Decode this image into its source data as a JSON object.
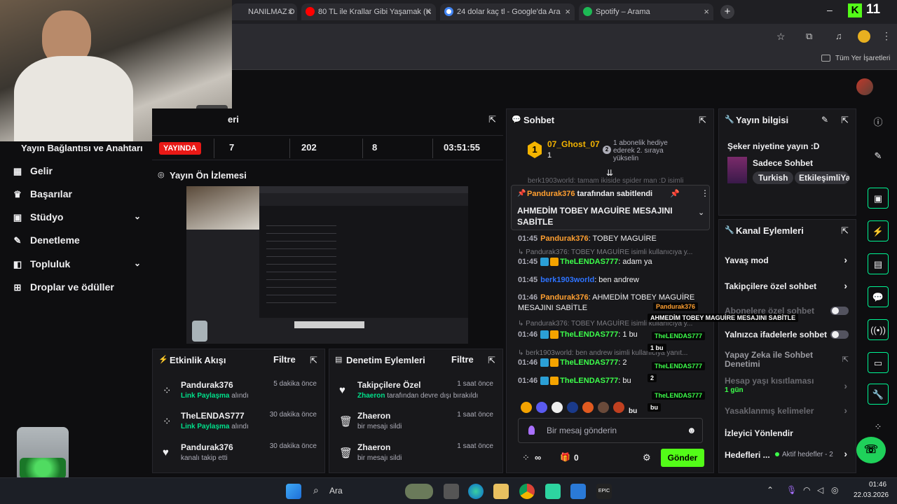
{
  "browser": {
    "tabs": [
      {
        "label": "NANILMAZ D",
        "color": "#cc3333"
      },
      {
        "label": "80 TL ile Krallar Gibi Yaşamak (K",
        "color": "#ff0000"
      },
      {
        "label": "24 dolar kaç tl - Google'da Ara",
        "color": "#4285f4"
      },
      {
        "label": "Spotify – Arama",
        "color": "#1db954"
      }
    ],
    "brand_count": "11",
    "bookmarks_label": "Tüm Yer İşaretleri"
  },
  "sidebar": {
    "top_item": "Yayın Bağlantısı ve Anahtarı",
    "items": [
      {
        "label": "Gelir",
        "icon": "money-icon"
      },
      {
        "label": "Başarılar",
        "icon": "trophy-icon"
      },
      {
        "label": "Stüdyo",
        "icon": "studio-icon"
      },
      {
        "label": "Denetleme",
        "icon": "wrench-icon"
      },
      {
        "label": "Topluluk",
        "icon": "community-icon"
      },
      {
        "label": "Droplar ve ödüller",
        "icon": "drops-icon"
      }
    ]
  },
  "stats": {
    "title_partial": "eri",
    "live_badge": "YAYINDA",
    "viewers": "7",
    "followers": "202",
    "subs": "8",
    "uptime": "03:51:55"
  },
  "preview": {
    "title": "Yayın Ön İzlemesi"
  },
  "activity": {
    "title": "Etkinlik Akışı",
    "filter": "Filtre",
    "rows": [
      {
        "name": "Pandurak376",
        "highlight": "Link Paylaşma",
        "rest": " alındı",
        "time": "5 dakika önce",
        "icon": "channel-points-icon"
      },
      {
        "name": "TheLENDAS777",
        "highlight": "Link Paylaşma",
        "rest": " alındı",
        "time": "30 dakika önce",
        "icon": "channel-points-icon"
      },
      {
        "name": "Pandurak376",
        "highlight": "",
        "rest": "kanalı takip etti",
        "time": "30 dakika önce",
        "icon": "heart-icon"
      }
    ]
  },
  "moderation": {
    "title": "Denetim Eylemleri",
    "filter": "Filtre",
    "rows": [
      {
        "name": "Takipçilere Özel",
        "highlight": "Zhaeron",
        "rest": " tarafından devre dışı bırakıldı",
        "time": "1 saat önce",
        "icon": "heart-icon"
      },
      {
        "name": "Zhaeron",
        "highlight": "",
        "rest": "bir mesajı sildi",
        "time": "1 saat önce",
        "icon": "trash-icon"
      },
      {
        "name": "Zhaeron",
        "highlight": "",
        "rest": "bir mesajı sildi",
        "time": "1 saat önce",
        "icon": "trash-icon"
      }
    ]
  },
  "chat": {
    "title": "Sohbet",
    "leader_rank": "1",
    "leader_name": "07_Ghost_07",
    "leader_count": "1",
    "hype_text": "1 abonelik hediye ederek 2. sıraya yükselin",
    "hype_num": "2",
    "scroll_ghost": "berk1903world: tamam ikiside spider man :D isimli",
    "pinned_by_user": "Pandurak376",
    "pinned_by_rest": " tarafından sabitlendi",
    "pinned_message": "AHMEDİM TOBEY MAGUİRE MESAJINI SABİTLE",
    "messages": [
      {
        "kind": "msg",
        "time": "01:45",
        "user": "Pandurak376",
        "ucls": "u1",
        "text": ": TOBEY MAGUİRE",
        "badges": false
      },
      {
        "kind": "reply",
        "text": "↳ Pandurak376: TOBEY MAGUİRE isimli kullanıcıya y..."
      },
      {
        "kind": "msg",
        "time": "01:45",
        "user": "TheLENDAS777",
        "ucls": "u2",
        "text": ": adam ya",
        "badges": true
      },
      {
        "kind": "msg",
        "time": "01:45",
        "user": "berk1903world",
        "ucls": "u3",
        "text": ": ben andrew",
        "badges": false
      },
      {
        "kind": "msg",
        "time": "01:46",
        "user": "Pandurak376",
        "ucls": "u1",
        "text": ": AHMEDİM TOBEY MAGUİRE MESAJINI SABİTLE",
        "badges": false
      },
      {
        "kind": "reply",
        "text": "↳ Pandurak376: TOBEY MAGUİRE isimli kullanıcıya y..."
      },
      {
        "kind": "msg",
        "time": "01:46",
        "user": "TheLENDAS777",
        "ucls": "u2",
        "text": ": 1 bu",
        "badges": true
      },
      {
        "kind": "reply",
        "text": "↳ berk1903world: ben andrew isimli kullanıcıya yanıt..."
      },
      {
        "kind": "msg",
        "time": "01:46",
        "user": "TheLENDAS777",
        "ucls": "u2",
        "text": ": 2",
        "badges": true
      },
      {
        "kind": "msg",
        "time": "01:46",
        "user": "TheLENDAS777",
        "ucls": "u2",
        "text": ": bu",
        "badges": true
      }
    ],
    "emote_text": "bu",
    "input_placeholder": "Bir mesaj gönderin",
    "points": "∞",
    "gift_count": "0",
    "send": "Gönder"
  },
  "stream_info": {
    "title": "Yayın bilgisi",
    "stream_title": "Şeker niyetine yayın :D",
    "category": "Sadece Sohbet",
    "tags": [
      "Turkish",
      "EtkileşimliYa"
    ]
  },
  "channel_actions": {
    "title": "Kanal Eylemleri",
    "items": [
      {
        "label": "Yavaş mod",
        "control": "arrow"
      },
      {
        "label": "Takipçilere özel sohbet",
        "control": "arrow"
      },
      {
        "label": "Abonelere özel sohbet",
        "control": "toggle"
      },
      {
        "label": "Yalnızca ifadelerle sohbet",
        "control": "toggle"
      },
      {
        "label": "Yapay Zeka ile Sohbet Denetimi",
        "control": "external"
      },
      {
        "label": "Hesap yaşı kısıtlaması",
        "sub": "1 gün",
        "control": "arrow"
      },
      {
        "label": "Yasaklanmış kelimeler",
        "control": "arrow"
      },
      {
        "label": "İzleyici Yönlendir",
        "control": "none"
      },
      {
        "label": "Hedefleri ...",
        "sub": "Aktif hedefler - 2",
        "control": "arrow"
      }
    ]
  },
  "overlays": {
    "o1": "Pandurak376",
    "o2": "AHMEDİM TOBEY MAGUİRE MESAJINI SABİTLE",
    "o3": "TheLENDAS777",
    "o4": "1 bu",
    "o5": "TheLENDAS777",
    "o6": "2",
    "o7": "TheLENDAS777",
    "o8": "bu"
  },
  "taskbar": {
    "search": "Ara",
    "time": "01:46",
    "date": "22.03.2026"
  },
  "colors": {
    "accent": "#00f593",
    "live": "#e91916"
  }
}
